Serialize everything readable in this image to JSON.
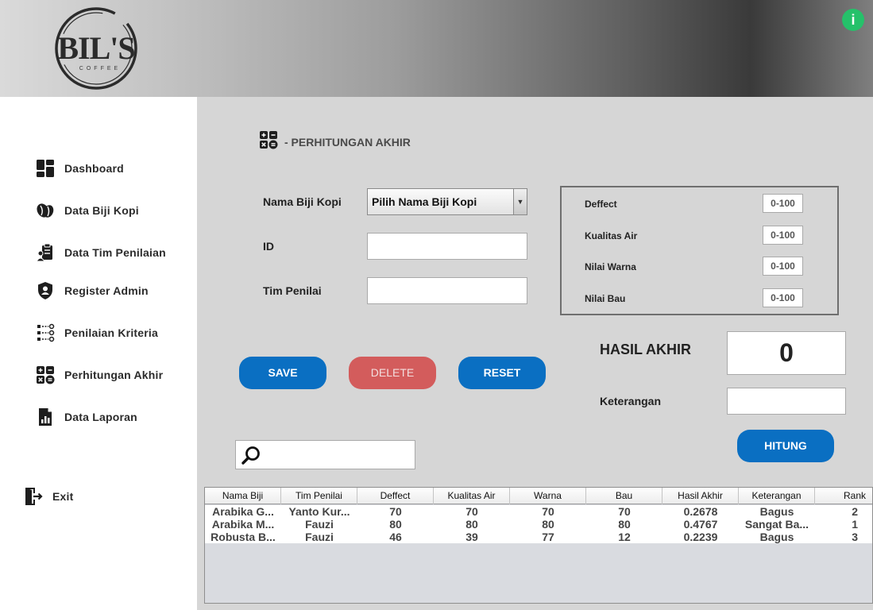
{
  "header": {
    "logo_text": "BIL'S",
    "logo_sub": "COFFEE",
    "info_icon": "info-icon",
    "info_symbol": "i"
  },
  "sidebar": {
    "items": [
      {
        "label": "Dashboard",
        "icon": "dashboard-icon"
      },
      {
        "label": "Data Biji Kopi",
        "icon": "coffee-bean-icon"
      },
      {
        "label": "Data Tim Penilaian",
        "icon": "team-clipboard-icon"
      },
      {
        "label": "Register Admin",
        "icon": "shield-user-icon"
      },
      {
        "label": "Penilaian Kriteria",
        "icon": "criteria-list-icon"
      },
      {
        "label": "Perhitungan Akhir",
        "icon": "calculator-icon"
      },
      {
        "label": "Data Laporan",
        "icon": "report-icon"
      }
    ],
    "exit_label": "Exit"
  },
  "page": {
    "title": "- PERHITUNGAN AKHIR"
  },
  "form": {
    "nama_label": "Nama Biji Kopi",
    "nama_selected": "Pilih Nama Biji Kopi",
    "id_label": "ID",
    "id_value": "",
    "tim_label": "Tim Penilai",
    "tim_value": ""
  },
  "criteria": [
    {
      "label": "Deffect",
      "placeholder": "0-100"
    },
    {
      "label": "Kualitas Air",
      "placeholder": "0-100"
    },
    {
      "label": "Nilai Warna",
      "placeholder": "0-100"
    },
    {
      "label": "Nilai Bau",
      "placeholder": "0-100"
    }
  ],
  "buttons": {
    "save": "SAVE",
    "delete": "DELETE",
    "reset": "RESET",
    "hitung": "HITUNG"
  },
  "result": {
    "hasil_label": "HASIL AKHIR",
    "hasil_value": "0",
    "keterangan_label": "Keterangan",
    "keterangan_value": ""
  },
  "search": {
    "value": ""
  },
  "table": {
    "columns": [
      "Nama Biji",
      "Tim Penilai",
      "Deffect",
      "Kualitas Air",
      "Warna",
      "Bau",
      "Hasil Akhir",
      "Keterangan",
      "Rank"
    ],
    "rows": [
      [
        "Arabika G...",
        "Yanto Kur...",
        "70",
        "70",
        "70",
        "70",
        "0.2678",
        "Bagus",
        "2"
      ],
      [
        "Arabika M...",
        "Fauzi",
        "80",
        "80",
        "80",
        "80",
        "0.4767",
        "Sangat Ba...",
        "1"
      ],
      [
        "Robusta B...",
        "Fauzi",
        "46",
        "39",
        "77",
        "12",
        "0.2239",
        "Bagus",
        "3"
      ]
    ]
  }
}
